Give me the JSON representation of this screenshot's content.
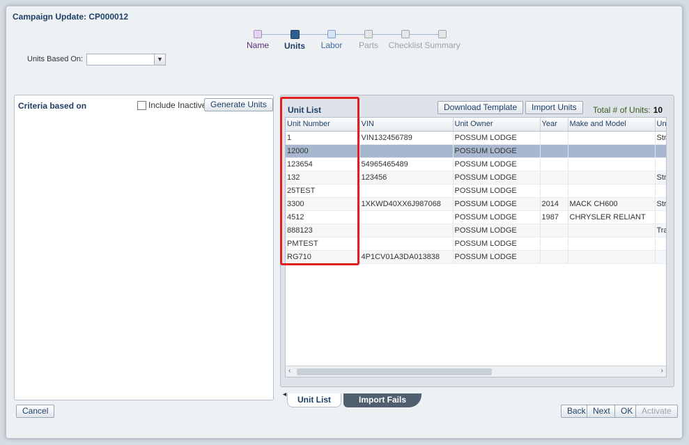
{
  "dialog": {
    "title": "Campaign Update: CP000012"
  },
  "train": {
    "steps": [
      {
        "label": "Name",
        "state": "visited"
      },
      {
        "label": "Units",
        "state": "current"
      },
      {
        "label": "Labor",
        "state": "next"
      },
      {
        "label": "Parts",
        "state": "disabled"
      },
      {
        "label": "Checklist",
        "state": "disabled"
      },
      {
        "label": "Summary",
        "state": "disabled"
      }
    ]
  },
  "units_based_on": {
    "label": "Units Based On:",
    "value": ""
  },
  "criteria": {
    "title": "Criteria based on",
    "include_inactive_label": "Include Inactive",
    "include_inactive_checked": false,
    "generate_button": "Generate Units"
  },
  "unit_list": {
    "title": "Unit List",
    "download_button": "Download Template",
    "import_button": "Import Units",
    "total_label": "Total # of Units:",
    "total_value": "10",
    "columns": [
      "Unit Number",
      "VIN",
      "Unit Owner",
      "Year",
      "Make and Model",
      "Un"
    ],
    "rows": [
      [
        "1",
        "VIN132456789",
        "POSSUM LODGE",
        "",
        "",
        "Str"
      ],
      [
        "12000",
        "",
        "POSSUM LODGE",
        "",
        "",
        ""
      ],
      [
        "123654",
        "54965465489",
        "POSSUM LODGE",
        "",
        "",
        ""
      ],
      [
        "132",
        "123456",
        "POSSUM LODGE",
        "",
        "",
        "Str"
      ],
      [
        "25TEST",
        "",
        "POSSUM LODGE",
        "",
        "",
        ""
      ],
      [
        "3300",
        "1XKWD40XX6J987068",
        "POSSUM LODGE",
        "2014",
        "MACK CH600",
        "Str"
      ],
      [
        "4512",
        "",
        "POSSUM LODGE",
        "1987",
        "CHRYSLER RELIANT",
        ""
      ],
      [
        "888123",
        "",
        "POSSUM LODGE",
        "",
        "",
        "Tra"
      ],
      [
        "PMTEST",
        "",
        "POSSUM LODGE",
        "",
        "",
        ""
      ],
      [
        "RG710",
        "4P1CV01A3DA013838",
        "POSSUM LODGE",
        "",
        "",
        ""
      ]
    ],
    "selected_row": 1
  },
  "tabs": {
    "active": "Unit List",
    "inactive": "Import Fails"
  },
  "buttons": {
    "cancel": "Cancel",
    "back": "Back",
    "next": "Next",
    "ok": "OK",
    "activate": "Activate"
  },
  "icons": {
    "left_arrow": "◄",
    "right_arrow": "►",
    "dropdown": "chevron-down-icon",
    "scroll_left": "‹",
    "scroll_right": "›"
  }
}
